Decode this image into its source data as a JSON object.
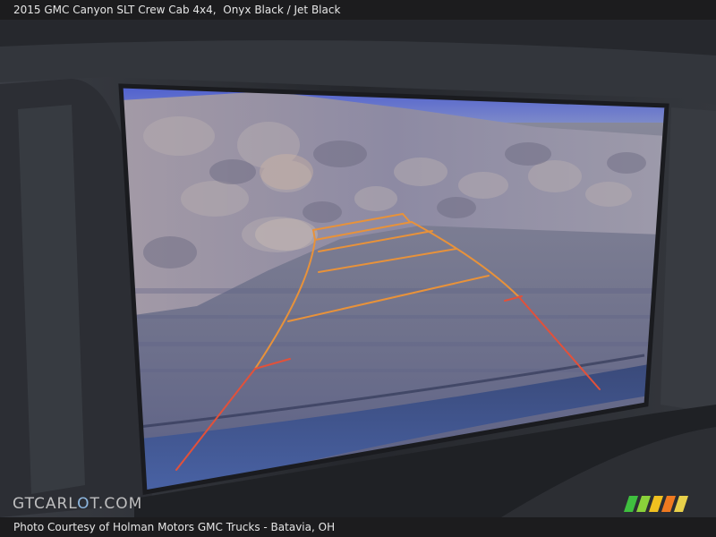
{
  "header": {
    "vehicle": "2015 GMC Canyon SLT Crew Cab 4x4,",
    "exterior_color": "Onyx Black",
    "separator": "/",
    "interior_color": "Jet Black"
  },
  "watermark": {
    "text_prefix": "GTC",
    "text_letter": "A",
    "text_middle": "RL",
    "text_o": "O",
    "text_suffix": "T.COM"
  },
  "footer": {
    "credit": "Photo Courtesy of Holman Motors GMC Trucks - Batavia, OH"
  },
  "colors": {
    "guide_orange": "#e8923a",
    "guide_red": "#e2513a",
    "screen_sky": "#6673c9",
    "bezel": "#2a2c31"
  },
  "icons": {
    "brand_logo": "dealer-stripes-logo"
  }
}
